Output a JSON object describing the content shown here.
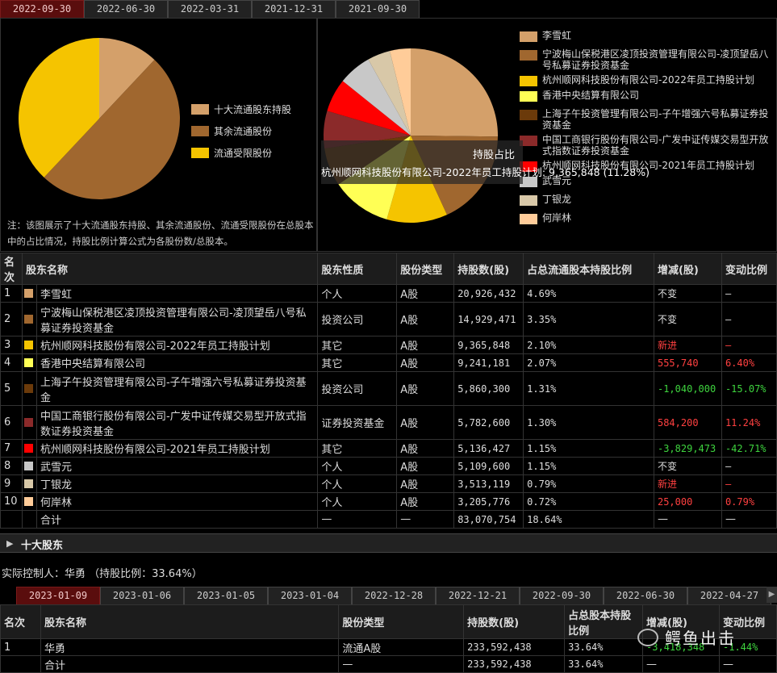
{
  "top_tabs": [
    "2022-09-30",
    "2022-06-30",
    "2022-03-31",
    "2021-12-31",
    "2021-09-30"
  ],
  "left_chart": {
    "legend": [
      "十大流通股东持股",
      "其余流通股份",
      "流通受限股份"
    ],
    "colors": [
      "#d4a06a",
      "#a0672f",
      "#f5c400"
    ],
    "note": "注：该图展示了十大流通股东持股、其余流通股份、流通受限股份在总股本中的占比情况，持股比例计算公式为各股份数/总股本。"
  },
  "right_chart": {
    "legend": [
      "李雪虹",
      "宁波梅山保税港区凌顶投资管理有限公司-凌顶望岳八号私募证券投资基金",
      "杭州顺网科技股份有限公司-2022年员工持股计划",
      "香港中央结算有限公司",
      "上海子午投资管理有限公司-子午增强六号私募证券投资基金",
      "中国工商银行股份有限公司-广发中证传媒交易型开放式指数证券投资基金",
      "杭州顺网科技股份有限公司-2021年员工持股计划",
      "武雪元",
      "丁银龙",
      "何岸林"
    ],
    "colors": [
      "#d4a06a",
      "#a0672f",
      "#f5c400",
      "#ffff55",
      "#6b3a0a",
      "#8b2a2a",
      "#ff0000",
      "#c8c8c8",
      "#d8c8a8",
      "#ffcc99"
    ],
    "tooltip_title": "持股占比",
    "tooltip_text": "杭州顺网科技股份有限公司-2022年员工持股计划: 9,365,848 (11.28%)"
  },
  "chart_data": [
    {
      "type": "pie",
      "title": "",
      "labels": [
        "十大流通股东持股",
        "其余流通股份",
        "流通受限股份"
      ],
      "values": [
        12.0,
        50.0,
        38.0
      ]
    },
    {
      "type": "pie",
      "title": "持股占比",
      "labels": [
        "李雪虹",
        "宁波梅山保税港区凌顶投资管理有限公司-凌顶望岳八号私募证券投资基金",
        "杭州顺网科技股份有限公司-2022年员工持股计划",
        "香港中央结算有限公司",
        "上海子午投资管理有限公司-子午增强六号私募证券投资基金",
        "中国工商银行股份有限公司-广发中证传媒交易型开放式指数证券投资基金",
        "杭州顺网科技股份有限公司-2021年员工持股计划",
        "武雪元",
        "丁银龙",
        "何岸林"
      ],
      "values": [
        20926432,
        14929471,
        9365848,
        9241181,
        5860300,
        5782600,
        5136427,
        5109600,
        3513119,
        3205776
      ]
    }
  ],
  "table1": {
    "headers": [
      "名次",
      "股东名称",
      "股东性质",
      "股份类型",
      "持股数(股)",
      "占总流通股本持股比例",
      "增减(股)",
      "变动比例"
    ],
    "rows": [
      {
        "rank": "1",
        "name": "李雪虹",
        "nature": "个人",
        "type": "A股",
        "shares": "20,926,432",
        "pct": "4.69%",
        "change": "不变",
        "chg_pct": "—",
        "cls": ""
      },
      {
        "rank": "2",
        "name": "宁波梅山保税港区凌顶投资管理有限公司-凌顶望岳八号私募证券投资基金",
        "nature": "投资公司",
        "type": "A股",
        "shares": "14,929,471",
        "pct": "3.35%",
        "change": "不变",
        "chg_pct": "—",
        "cls": ""
      },
      {
        "rank": "3",
        "name": "杭州顺网科技股份有限公司-2022年员工持股计划",
        "nature": "其它",
        "type": "A股",
        "shares": "9,365,848",
        "pct": "2.10%",
        "change": "新进",
        "chg_pct": "—",
        "cls": "red"
      },
      {
        "rank": "4",
        "name": "香港中央结算有限公司",
        "nature": "其它",
        "type": "A股",
        "shares": "9,241,181",
        "pct": "2.07%",
        "change": "555,740",
        "chg_pct": "6.40%",
        "cls": "red"
      },
      {
        "rank": "5",
        "name": "上海子午投资管理有限公司-子午增强六号私募证券投资基金",
        "nature": "投资公司",
        "type": "A股",
        "shares": "5,860,300",
        "pct": "1.31%",
        "change": "-1,040,000",
        "chg_pct": "-15.07%",
        "cls": "green"
      },
      {
        "rank": "6",
        "name": "中国工商银行股份有限公司-广发中证传媒交易型开放式指数证券投资基金",
        "nature": "证券投资基金",
        "type": "A股",
        "shares": "5,782,600",
        "pct": "1.30%",
        "change": "584,200",
        "chg_pct": "11.24%",
        "cls": "red"
      },
      {
        "rank": "7",
        "name": "杭州顺网科技股份有限公司-2021年员工持股计划",
        "nature": "其它",
        "type": "A股",
        "shares": "5,136,427",
        "pct": "1.15%",
        "change": "-3,829,473",
        "chg_pct": "-42.71%",
        "cls": "green"
      },
      {
        "rank": "8",
        "name": "武雪元",
        "nature": "个人",
        "type": "A股",
        "shares": "5,109,600",
        "pct": "1.15%",
        "change": "不变",
        "chg_pct": "—",
        "cls": ""
      },
      {
        "rank": "9",
        "name": "丁银龙",
        "nature": "个人",
        "type": "A股",
        "shares": "3,513,119",
        "pct": "0.79%",
        "change": "新进",
        "chg_pct": "—",
        "cls": "red"
      },
      {
        "rank": "10",
        "name": "何岸林",
        "nature": "个人",
        "type": "A股",
        "shares": "3,205,776",
        "pct": "0.72%",
        "change": "25,000",
        "chg_pct": "0.79%",
        "cls": "red"
      }
    ],
    "total": {
      "label": "合计",
      "nature": "—",
      "type": "—",
      "shares": "83,070,754",
      "pct": "18.64%",
      "change": "—",
      "chg_pct": "—"
    }
  },
  "section_title": "十大股东",
  "controller_text": "实际控制人：华勇 （持股比例：33.64%）",
  "bottom_tabs": [
    "2023-01-09",
    "2023-01-06",
    "2023-01-05",
    "2023-01-04",
    "2022-12-28",
    "2022-12-21",
    "2022-09-30",
    "2022-06-30",
    "2022-04-27"
  ],
  "table2": {
    "headers": [
      "名次",
      "股东名称",
      "股份类型",
      "持股数(股)",
      "占总股本持股比例",
      "增减(股)",
      "变动比例"
    ],
    "rows": [
      {
        "rank": "1",
        "name": "华勇",
        "type": "流通A股",
        "shares": "233,592,438",
        "pct": "33.64%",
        "change": "-3,418,348",
        "chg_pct": "-1.44%"
      }
    ],
    "total": {
      "label": "合计",
      "type": "—",
      "shares": "233,592,438",
      "pct": "33.64%",
      "change": "—",
      "chg_pct": "—"
    }
  },
  "watermark": "鳄鱼出击"
}
